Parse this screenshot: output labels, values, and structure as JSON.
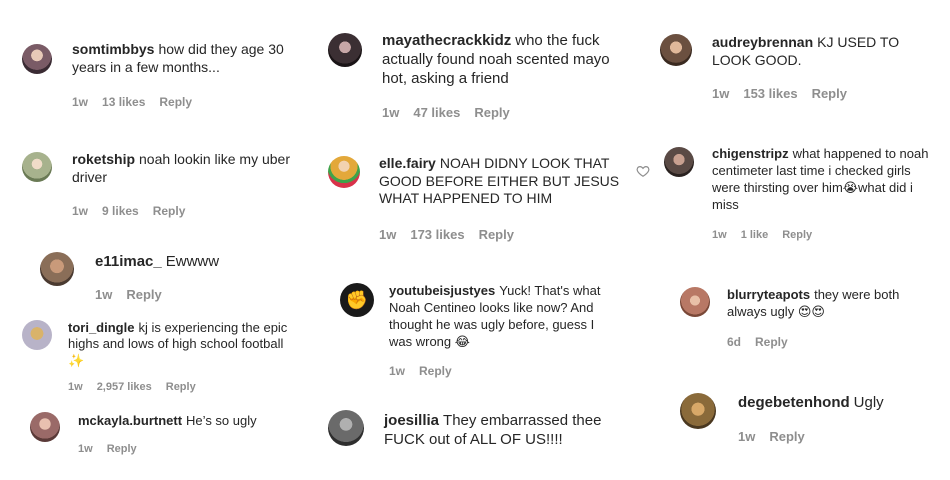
{
  "comments": [
    {
      "user": "somtimbbys",
      "text": "how did they age 30 years in a few months...",
      "time": "1w",
      "likes": "13 likes",
      "reply": "Reply",
      "avatar_color": "#7a5b66"
    },
    {
      "user": "roketship",
      "text": "noah lookin like my uber driver",
      "time": "1w",
      "likes": "9 likes",
      "reply": "Reply",
      "avatar_color": "#a7b28d"
    },
    {
      "user": "e11imac_",
      "text": "Ewwww",
      "time": "1w",
      "reply": "Reply",
      "avatar_color": "#8a6e58"
    },
    {
      "user": "tori_dingle",
      "text": "kj is experiencing the epic highs and lows of high school football",
      "emoji": "✨",
      "time": "1w",
      "likes": "2,957 likes",
      "reply": "Reply",
      "avatar_color": "#b8b3c8"
    },
    {
      "user": "mckayla.burtnett",
      "text": "He’s so ugly",
      "time": "1w",
      "reply": "Reply",
      "avatar_color": "#9a6a68"
    },
    {
      "user": "mayathecrackkidz",
      "text": "who the fuck actually found noah scented mayo hot, asking a friend",
      "time": "1w",
      "likes": "47 likes",
      "reply": "Reply",
      "avatar_color": "#3b2f33"
    },
    {
      "user": "elle.fairy",
      "text": "NOAH DIDNY LOOK THAT GOOD BEFORE EITHER BUT JESUS WHAT HAPPENED TO HIM",
      "time": "1w",
      "likes": "173 likes",
      "reply": "Reply",
      "avatar_color": "#e3a83a"
    },
    {
      "user": "youtubeisjustyes",
      "text": "Yuck! That's what Noah Centineo looks like now? And thought he was ugly before, guess I was wrong",
      "emoji": "😂",
      "time": "1w",
      "reply": "Reply",
      "avatar_color": "#1a1a1a"
    },
    {
      "user": "joesillia",
      "text": "They embarrassed thee FUCK out of ALL OF US!!!!",
      "time": "",
      "reply": "",
      "avatar_color": "#6a6a6a"
    },
    {
      "user": "audreybrennan",
      "text": "KJ USED TO LOOK GOOD.",
      "time": "1w",
      "likes": "153 likes",
      "reply": "Reply",
      "avatar_color": "#6b5040"
    },
    {
      "user": "chigenstripz",
      "text": "what happened to noah centimeter last time i checked girls were thirsting over him",
      "emoji": "😭",
      "text_after": "what did i miss",
      "time": "1w",
      "likes": "1 like",
      "reply": "Reply",
      "avatar_color": "#5a4a45"
    },
    {
      "user": "blurryteapots",
      "text": "they were both always ugly",
      "emoji": "😍😍",
      "time": "6d",
      "reply": "Reply",
      "avatar_color": "#b87865"
    },
    {
      "user": "degebetenhond",
      "text": "Ugly",
      "time": "1w",
      "reply": "Reply",
      "avatar_color": "#8a6a3a"
    }
  ]
}
